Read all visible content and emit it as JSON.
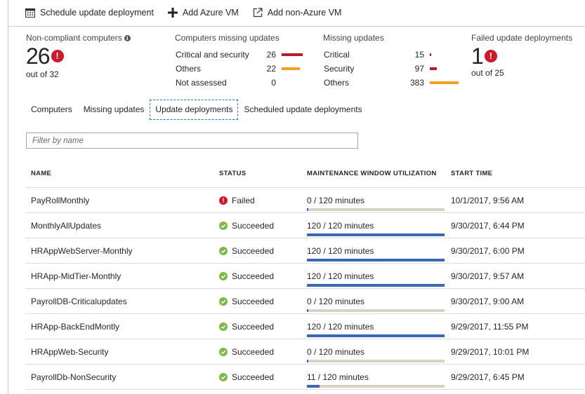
{
  "toolbar": {
    "schedule_label": "Schedule update deployment",
    "add_azure_label": "Add Azure VM",
    "add_non_azure_label": "Add non-Azure VM"
  },
  "summary": {
    "noncompliant": {
      "title": "Non-compliant computers",
      "value": "26",
      "out_of": "out of 32"
    },
    "missing_computers": {
      "title": "Computers missing updates",
      "rows": [
        {
          "label": "Critical and security",
          "value": "26",
          "color": "#c0172a",
          "fraction": 1.0
        },
        {
          "label": "Others",
          "value": "22",
          "color": "#f1a01f",
          "fraction": 0.85
        },
        {
          "label": "Not assessed",
          "value": "0",
          "color": "#c0172a",
          "fraction": 0
        }
      ]
    },
    "missing_updates": {
      "title": "Missing updates",
      "rows": [
        {
          "label": "Critical",
          "value": "15",
          "color": "#c0172a",
          "fraction": 0.04
        },
        {
          "label": "Security",
          "value": "97",
          "color": "#c0172a",
          "fraction": 0.25
        },
        {
          "label": "Others",
          "value": "383",
          "color": "#f1a01f",
          "fraction": 1.0
        }
      ]
    },
    "failed": {
      "title": "Failed update deployments",
      "value": "1",
      "out_of": "out of 25"
    }
  },
  "tabs": [
    "Computers",
    "Missing updates",
    "Update deployments",
    "Scheduled update deployments"
  ],
  "active_tab": "Update deployments",
  "filter": {
    "placeholder": "Filter by name"
  },
  "table": {
    "headers": [
      "NAME",
      "STATUS",
      "MAINTENANCE WINDOW UTILIZATION",
      "START TIME"
    ],
    "rows": [
      {
        "name": "PayRollMonthly",
        "status": "Failed",
        "used": 0,
        "total": 120,
        "util_label": "0 / 120 minutes",
        "start": "10/1/2017, 9:56 AM"
      },
      {
        "name": "MonthlyAllUpdates",
        "status": "Succeeded",
        "used": 120,
        "total": 120,
        "util_label": "120 / 120 minutes",
        "start": "9/30/2017, 6:44 PM"
      },
      {
        "name": "HRAppWebServer-Monthly",
        "status": "Succeeded",
        "used": 120,
        "total": 120,
        "util_label": "120 / 120 minutes",
        "start": "9/30/2017, 6:00 PM"
      },
      {
        "name": "HRApp-MidTier-Monthly",
        "status": "Succeeded",
        "used": 120,
        "total": 120,
        "util_label": "120 / 120 minutes",
        "start": "9/30/2017, 9:57 AM"
      },
      {
        "name": "PayrollDB-Criticalupdates",
        "status": "Succeeded",
        "used": 0,
        "total": 120,
        "util_label": "0 / 120 minutes",
        "start": "9/30/2017, 9:00 AM"
      },
      {
        "name": "HRApp-BackEndMontly",
        "status": "Succeeded",
        "used": 120,
        "total": 120,
        "util_label": "120 / 120 minutes",
        "start": "9/29/2017, 11:55 PM"
      },
      {
        "name": "HRAppWeb-Security",
        "status": "Succeeded",
        "used": 0,
        "total": 120,
        "util_label": "0 / 120 minutes",
        "start": "9/29/2017, 10:01 PM"
      },
      {
        "name": "PayrollDb-NonSecurity",
        "status": "Succeeded",
        "used": 11,
        "total": 120,
        "util_label": "11 / 120 minutes",
        "start": "9/29/2017, 6:45 PM"
      }
    ]
  },
  "colors": {
    "accent": "#1b7bc4",
    "fail": "#d0182b",
    "success": "#7db944",
    "util_fill": "#3a68b5"
  }
}
